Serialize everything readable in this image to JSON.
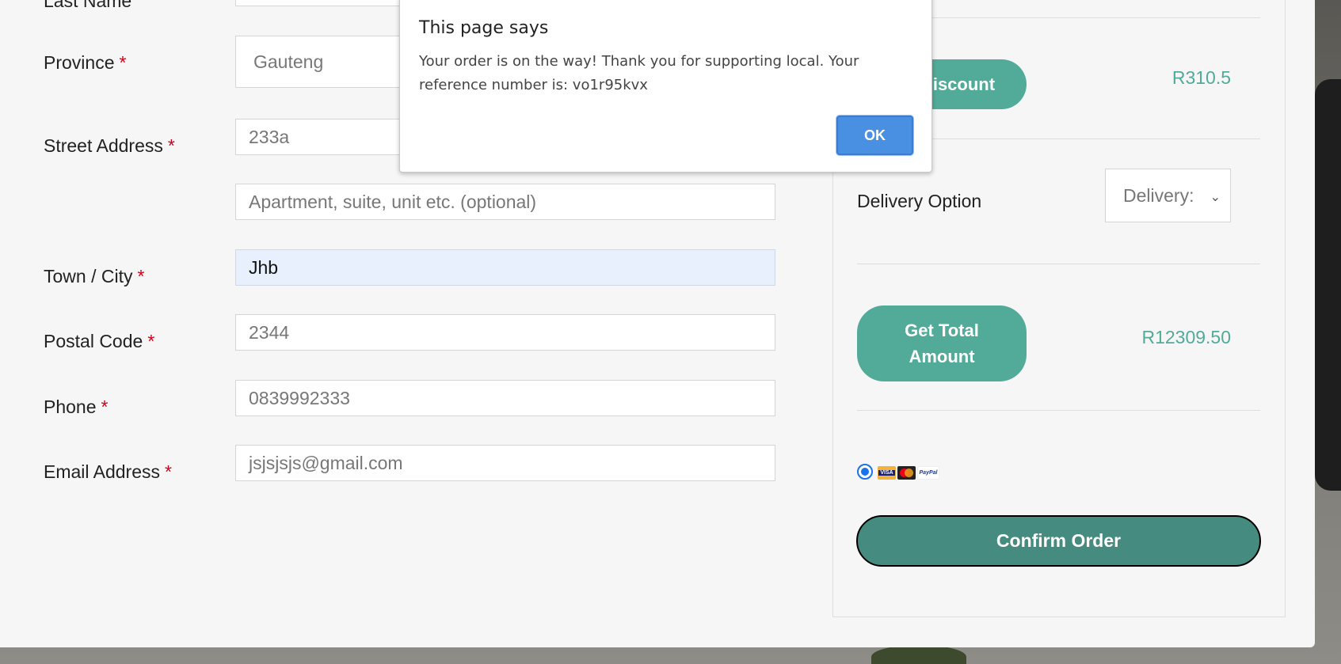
{
  "form": {
    "required_mark": "*",
    "last_name_label": "Last Name",
    "province_label": "Province",
    "province_value": "Gauteng",
    "street_label": "Street Address",
    "street_value": "233a",
    "apartment_placeholder": "Apartment, suite, unit etc. (optional)",
    "town_label": "Town / City",
    "town_value": "Jhb",
    "postal_label": "Postal Code",
    "postal_value": "2344",
    "phone_label": "Phone",
    "phone_value": "0839992333",
    "email_label": "Email Address",
    "email_value": "jsjsjsjs@gmail.com"
  },
  "summary": {
    "discount_button": "Discount",
    "discount_amount": "R310.5",
    "delivery_label": "Delivery Option",
    "delivery_select": "Delivery:",
    "total_button": "Get Total Amount",
    "total_amount": "R12309.50",
    "payment_icons": [
      "visa-card",
      "mastercard",
      "paypal"
    ],
    "visa_text": "VISA",
    "paypal_text": "PayPal",
    "confirm_button": "Confirm Order"
  },
  "dialog": {
    "title": "This page says",
    "message": "Your order is on the way! Thank you for supporting local. Your reference number is: vo1r95kvx",
    "ok_label": "OK"
  },
  "colors": {
    "accent": "#52ab98",
    "confirm": "#458b7f",
    "required": "#d0021b",
    "ok_button": "#4a90e2"
  }
}
